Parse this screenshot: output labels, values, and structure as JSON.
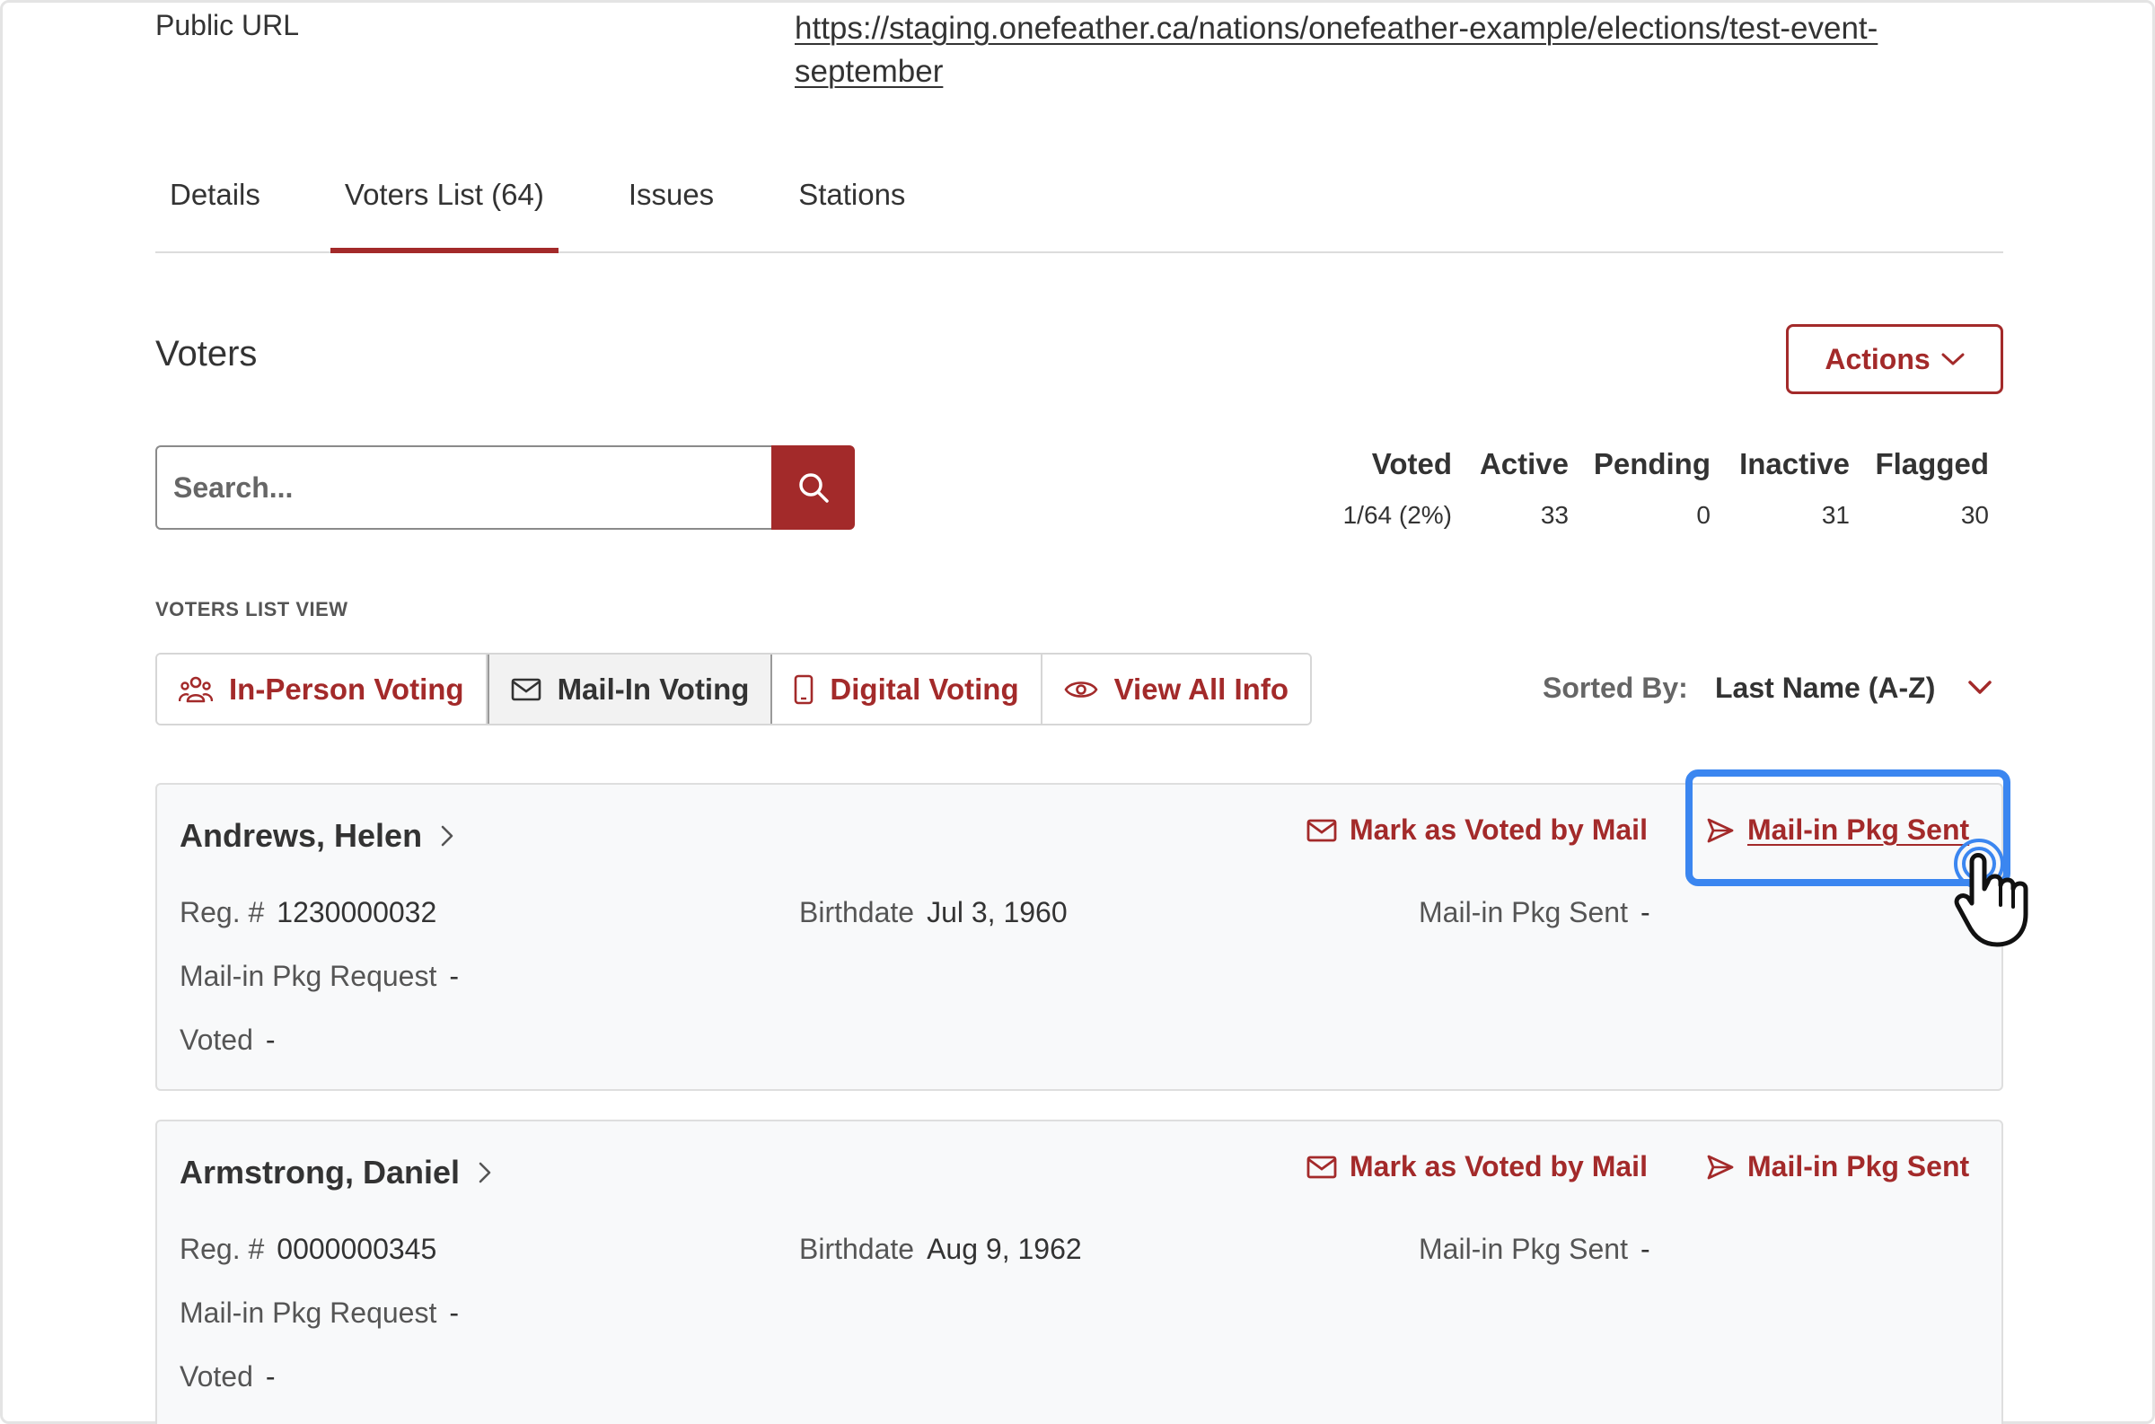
{
  "public_url": {
    "label": "Public URL",
    "link": "https://staging.onefeather.ca/nations/onefeather-example/elections/test-event-september"
  },
  "tabs": [
    {
      "label": "Details"
    },
    {
      "label": "Voters List (64)",
      "active": true
    },
    {
      "label": "Issues"
    },
    {
      "label": "Stations"
    }
  ],
  "voters": {
    "heading": "Voters",
    "actions_label": "Actions",
    "search_placeholder": "Search..."
  },
  "stats": {
    "headers": [
      "Voted",
      "Active",
      "Pending",
      "Inactive",
      "Flagged"
    ],
    "values": [
      "1/64 (2%)",
      "33",
      "0",
      "31",
      "30"
    ]
  },
  "list_view": {
    "label": "VOTERS LIST VIEW",
    "options": [
      {
        "label": "In-Person Voting",
        "icon": "users-icon"
      },
      {
        "label": "Mail-In Voting",
        "icon": "mail-icon",
        "selected": true
      },
      {
        "label": "Digital Voting",
        "icon": "phone-icon"
      },
      {
        "label": "View All Info",
        "icon": "eye-icon"
      }
    ]
  },
  "sort": {
    "label": "Sorted By:",
    "value": "Last Name (A-Z)"
  },
  "cards": [
    {
      "name": "Andrews, Helen",
      "mark_label": "Mark as Voted by Mail",
      "sent_label": "Mail-in Pkg Sent",
      "reg_label": "Reg. #",
      "reg_value": "1230000032",
      "birth_label": "Birthdate",
      "birth_value": "Jul 3, 1960",
      "pkg_sent_label": "Mail-in Pkg Sent",
      "pkg_sent_value": "-",
      "pkg_request_label": "Mail-in Pkg Request",
      "pkg_request_value": "-",
      "voted_label": "Voted",
      "voted_value": "-"
    },
    {
      "name": "Armstrong, Daniel",
      "mark_label": "Mark as Voted by Mail",
      "sent_label": "Mail-in Pkg Sent",
      "reg_label": "Reg. #",
      "reg_value": "0000000345",
      "birth_label": "Birthdate",
      "birth_value": "Aug 9, 1962",
      "pkg_sent_label": "Mail-in Pkg Sent",
      "pkg_sent_value": "-",
      "pkg_request_label": "Mail-in Pkg Request",
      "pkg_request_value": "-",
      "voted_label": "Voted",
      "voted_value": "-"
    }
  ],
  "colors": {
    "accent": "#a32a2a",
    "highlight": "#3b86f0",
    "card_bg": "#f8f9fa"
  }
}
